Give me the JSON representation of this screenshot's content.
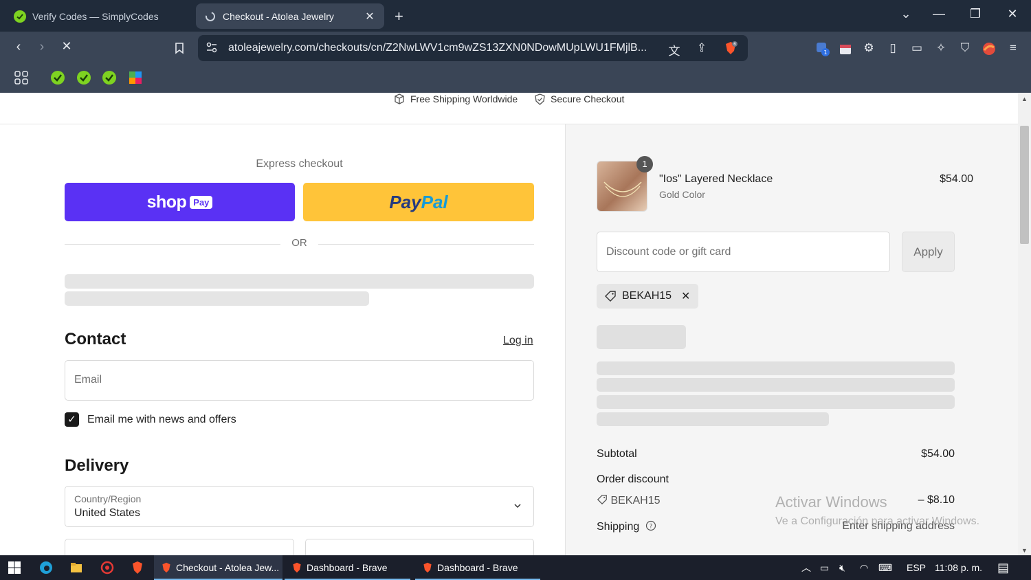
{
  "browser": {
    "tabs": [
      {
        "title": "Verify Codes — SimplyCodes",
        "active": false
      },
      {
        "title": "Checkout - Atolea Jewelry",
        "active": true
      }
    ],
    "url": "atoleajewelry.com/checkouts/cn/Z2NwLWV1cm9wZS13ZXN0NDowMUpLWU1FMjlB...",
    "brave_badge": "6",
    "ext_badge": "1"
  },
  "banner": {
    "shipping": "Free Shipping Worldwide",
    "secure": "Secure Checkout"
  },
  "checkout": {
    "express_label": "Express checkout",
    "shoppay_text": "shop",
    "shoppay_badge": "Pay",
    "paypal_p1": "Pay",
    "paypal_p2": "Pal",
    "or": "OR",
    "contact_title": "Contact",
    "login": "Log in",
    "email_placeholder": "Email",
    "news_checkbox": "Email me with news and offers",
    "news_checked": true,
    "delivery_title": "Delivery",
    "country_label": "Country/Region",
    "country_value": "United States"
  },
  "summary": {
    "product_name": "\"Ios\" Layered Necklace",
    "product_variant": "Gold Color",
    "product_price": "$54.00",
    "quantity": "1",
    "discount_placeholder": "Discount code or gift card",
    "apply": "Apply",
    "applied_code": "BEKAH15",
    "subtotal_label": "Subtotal",
    "subtotal_value": "$54.00",
    "order_discount_label": "Order discount",
    "discount_code": "BEKAH15",
    "discount_value": "– $8.10",
    "shipping_label": "Shipping",
    "shipping_value": "Enter shipping address"
  },
  "watermark": {
    "title": "Activar Windows",
    "subtitle": "Ve a Configuración para activar Windows."
  },
  "taskbar": {
    "apps": [
      {
        "label": "Checkout - Atolea Jew...",
        "active": true
      },
      {
        "label": "Dashboard - Brave",
        "active": false
      },
      {
        "label": "Dashboard - Brave",
        "active": false
      }
    ],
    "lang": "ESP",
    "time": "11:08 p. m."
  },
  "colors": {
    "shoppay": "#5a31f4",
    "paypal": "#ffc439",
    "chrome_dark": "#202b3a",
    "chrome_mid": "#3a4556"
  }
}
